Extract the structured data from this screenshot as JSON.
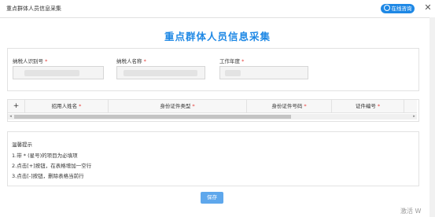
{
  "window": {
    "title": "重点群体人员信息采集",
    "online_label": "在线咨询",
    "close_glyph": "✕"
  },
  "page": {
    "title": "重点群体人员信息采集"
  },
  "form": {
    "fields": [
      {
        "label": "纳税人识别号",
        "value": ""
      },
      {
        "label": "纳税人名称",
        "value": ""
      },
      {
        "label": "工作年度",
        "value": ""
      }
    ],
    "required_mark": "*"
  },
  "grid": {
    "add_glyph": "+",
    "columns": [
      "招用人姓名",
      "身份证件类型",
      "身份证件号码",
      "证件编号"
    ],
    "scroll_left": "◂",
    "scroll_right": "▸"
  },
  "tips": {
    "title": "温馨提示",
    "lines": [
      "1.带 * (星号)的项目为必填项",
      "2.点击[+]按钮，在表格增加一空行",
      "3.点击[-]按钮，删除表格当前行"
    ]
  },
  "actions": {
    "save_label": "保存"
  },
  "watermark": "激活 W"
}
